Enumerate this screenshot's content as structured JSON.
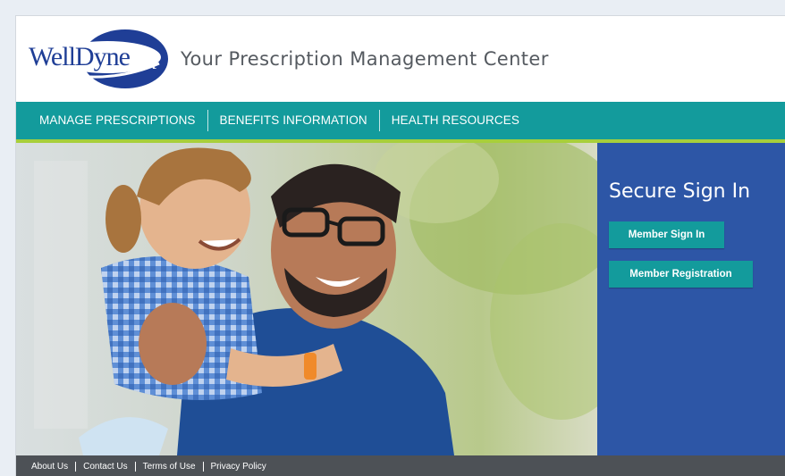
{
  "brand": {
    "logo_text": "WellDyneRx",
    "tagline": "Your Prescription Management Center"
  },
  "nav": {
    "items": [
      {
        "label": "MANAGE PRESCRIPTIONS"
      },
      {
        "label": "BENEFITS INFORMATION"
      },
      {
        "label": "HEALTH RESOURCES"
      }
    ]
  },
  "signin": {
    "title": "Secure Sign In",
    "member_signin_label": "Member Sign In",
    "member_registration_label": "Member Registration"
  },
  "footer": {
    "links": [
      {
        "label": "About Us"
      },
      {
        "label": "Contact Us"
      },
      {
        "label": "Terms of Use"
      },
      {
        "label": "Privacy Policy"
      }
    ]
  },
  "colors": {
    "nav_teal": "#139b9c",
    "accent_green": "#a7cf3b",
    "panel_blue": "#2d56a6",
    "footer_gray": "#4d5156",
    "logo_blue": "#1f3e96"
  }
}
